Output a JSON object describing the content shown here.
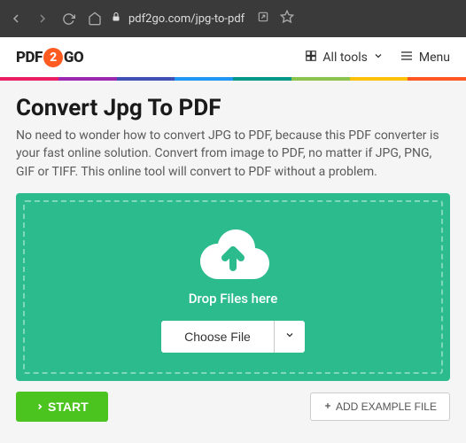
{
  "browser": {
    "url": "pdf2go.com/jpg-to-pdf"
  },
  "logo": {
    "part1": "PDF",
    "part2": "2",
    "part3": "GO"
  },
  "header": {
    "all_tools": "All tools",
    "menu": "Menu"
  },
  "page": {
    "title": "Convert Jpg To PDF",
    "description": "No need to wonder how to convert JPG to PDF, because this PDF converter is your fast online solution. Convert from image to PDF, no matter if JPG, PNG, GIF or TIFF. This online tool will convert to PDF without a problem."
  },
  "dropzone": {
    "prompt": "Drop Files here",
    "choose_label": "Choose File"
  },
  "actions": {
    "start": "START",
    "example": "ADD EXAMPLE FILE"
  }
}
